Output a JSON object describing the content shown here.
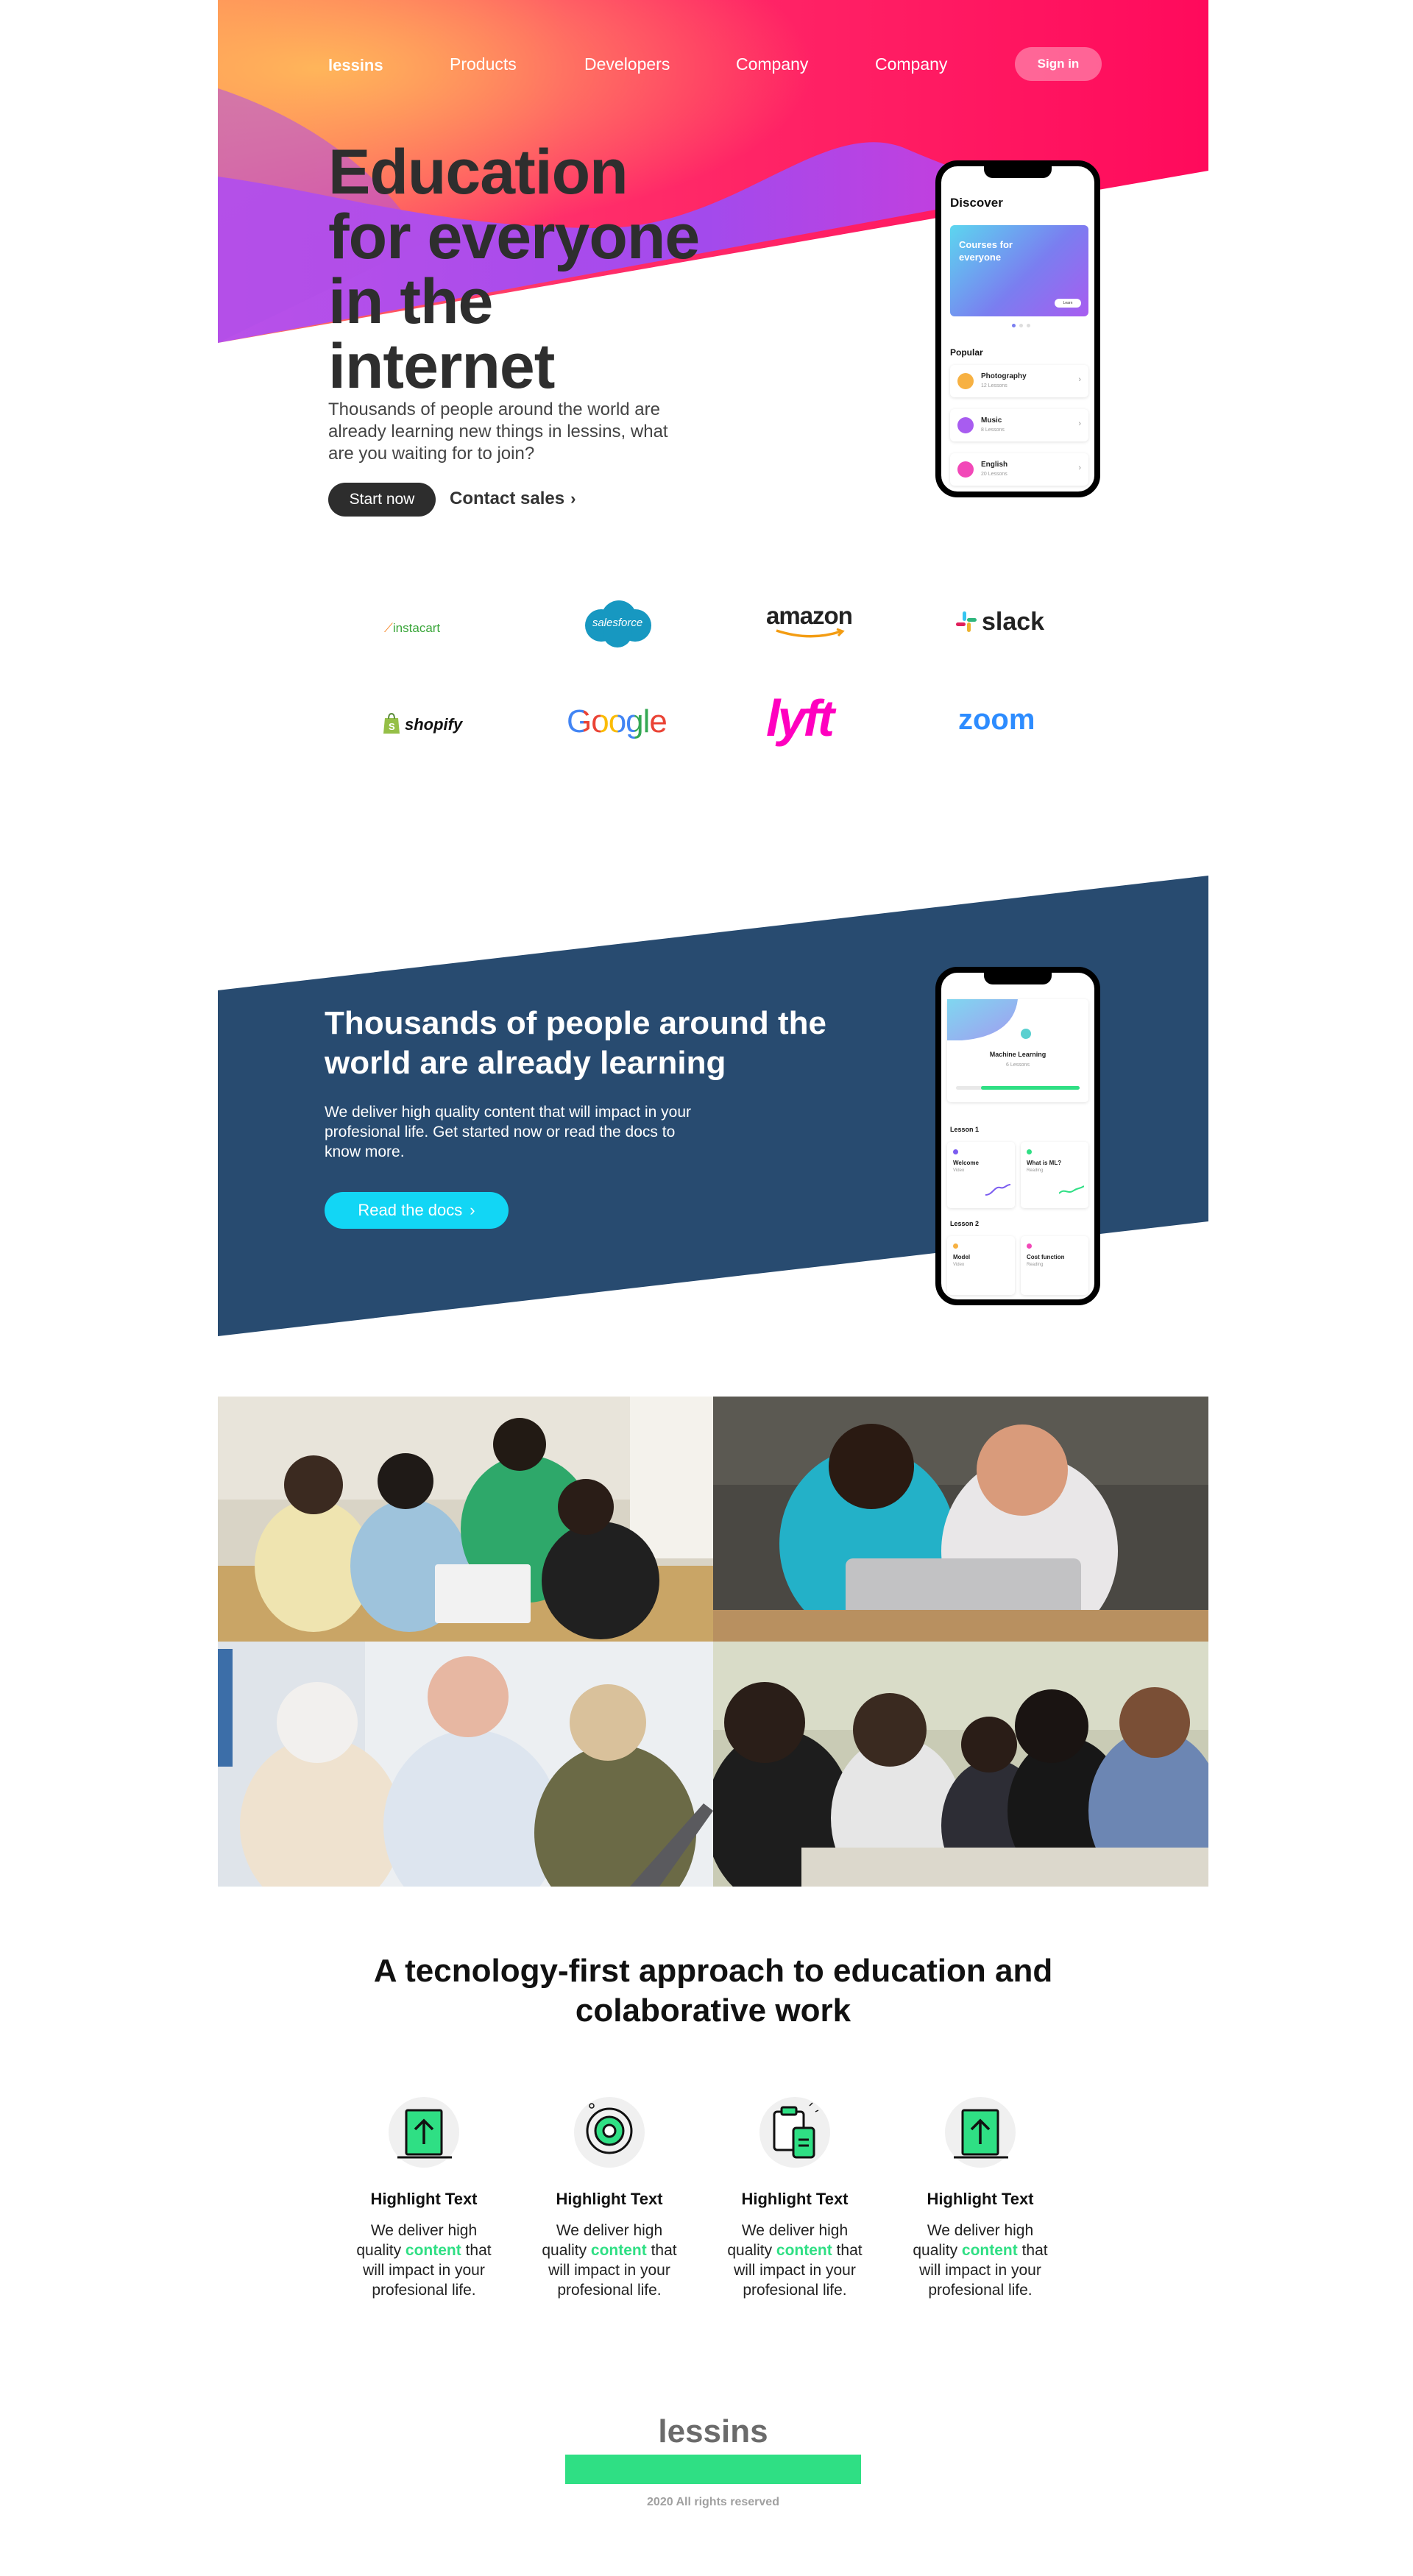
{
  "nav": {
    "brand": "lessins",
    "links": [
      "Products",
      "Developers",
      "Company",
      "Company"
    ],
    "signin_label": "Sign in"
  },
  "hero": {
    "title_lines": [
      "Education",
      "for everyone",
      "in the",
      "internet"
    ],
    "subtitle": "Thousands of people around the world are already learning new things in lessins, what are you waiting for to join?",
    "cta_primary": "Start now",
    "cta_secondary": "Contact sales"
  },
  "phone_discover": {
    "heading": "Discover",
    "banner_text": "Courses for everyone",
    "banner_button": "Learn",
    "section_label": "Popular",
    "courses": [
      {
        "title": "Photography",
        "meta": "12 Lessons",
        "color": "#f7b142"
      },
      {
        "title": "Music",
        "meta": "8 Lessons",
        "color": "#a85cf0"
      },
      {
        "title": "English",
        "meta": "20 Lessons",
        "color": "#f248b8"
      }
    ]
  },
  "logos": [
    "instacart",
    "salesforce",
    "amazon",
    "slack",
    "shopify",
    "Google",
    "lyft",
    "zoom"
  ],
  "band": {
    "title": "Thousands of people around the world are already learning",
    "subtitle": "We deliver high quality content that will impact in your profesional life. Get started now or read the docs to know more.",
    "cta": "Read the docs"
  },
  "phone_ml": {
    "course_title": "Machine Learning",
    "course_meta": "6 Lessons",
    "progress": 0.8,
    "lesson1_label": "Lesson 1",
    "lesson1_items": [
      {
        "title": "Welcome",
        "meta": "Video",
        "color": "#7b5cf0"
      },
      {
        "title": "What is ML?",
        "meta": "Reading",
        "color": "#2fdf84"
      }
    ],
    "lesson2_label": "Lesson 2",
    "lesson2_items": [
      {
        "title": "Model",
        "meta": "Video",
        "color": "#f7b142"
      },
      {
        "title": "Cost function",
        "meta": "Reading",
        "color": "#f248b8"
      }
    ]
  },
  "photos": [
    "students-group-laptop",
    "children-tablet",
    "seniors-laptop",
    "women-study-group"
  ],
  "highlights": {
    "title": "A tecnology-first approach to education and colaborative work",
    "items": [
      {
        "icon": "laptop-upload-icon",
        "title": "Highlight Text",
        "pre": "We deliver high quality ",
        "accent": "content",
        "post": " that will impact in your profesional life."
      },
      {
        "icon": "target-icon",
        "title": "Highlight Text",
        "pre": "We deliver high quality ",
        "accent": "content",
        "post": " that will impact in your profesional life."
      },
      {
        "icon": "clipboard-phone-icon",
        "title": "Highlight Text",
        "pre": "We deliver high quality ",
        "accent": "content",
        "post": " that will impact in your profesional life."
      },
      {
        "icon": "laptop-upload-icon",
        "title": "Highlight Text",
        "pre": "We deliver high quality ",
        "accent": "content",
        "post": " that will impact in your profesional life."
      }
    ]
  },
  "footer": {
    "brand": "lessins",
    "copyright": "2020 All rights reserved"
  },
  "colors": {
    "accent_green": "#2fdf84",
    "band_navy": "#284b70",
    "docs_cyan": "#12d6f5",
    "hero_pink": "#ff0a64",
    "hero_purple": "#9a50f0",
    "hero_orange": "#ffa255"
  }
}
